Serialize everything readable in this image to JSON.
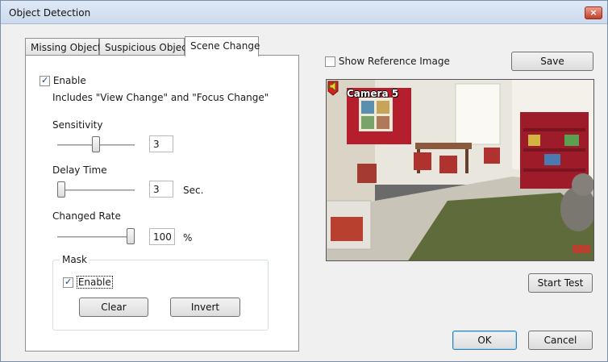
{
  "window": {
    "title": "Object Detection",
    "close_glyph": "×"
  },
  "tabs": [
    {
      "label": "Missing Object",
      "active": false
    },
    {
      "label": "Suspicious Object",
      "active": false
    },
    {
      "label": "Scene Change",
      "active": true
    }
  ],
  "scene_change": {
    "enable_label": "Enable",
    "enable_checked": true,
    "description": "Includes \"View Change\" and \"Focus Change\"",
    "sensitivity": {
      "label": "Sensitivity",
      "value": "3",
      "level": 0.5
    },
    "delay_time": {
      "label": "Delay Time",
      "value": "3",
      "unit": "Sec.",
      "level": 0.0
    },
    "changed_rate": {
      "label": "Changed Rate",
      "value": "100",
      "unit": "%",
      "level": 1.0
    },
    "mask": {
      "title": "Mask",
      "enable_label": "Enable",
      "enable_checked": true,
      "clear_label": "Clear",
      "invert_label": "Invert"
    }
  },
  "preview": {
    "show_reference_label": "Show Reference Image",
    "show_reference_checked": false,
    "save_label": "Save",
    "camera_label": "Camera 5",
    "start_test_label": "Start Test"
  },
  "footer": {
    "ok_label": "OK",
    "cancel_label": "Cancel"
  },
  "icons": {
    "camera_status": "camera-status-icon",
    "speaker": "speaker-icon",
    "close": "close-icon"
  },
  "colors": {
    "title_bar": "#cbdaee",
    "close_button": "#c2402a",
    "default_button_border": "#3c7fb1",
    "camera_status_red": "#d81f1f"
  }
}
